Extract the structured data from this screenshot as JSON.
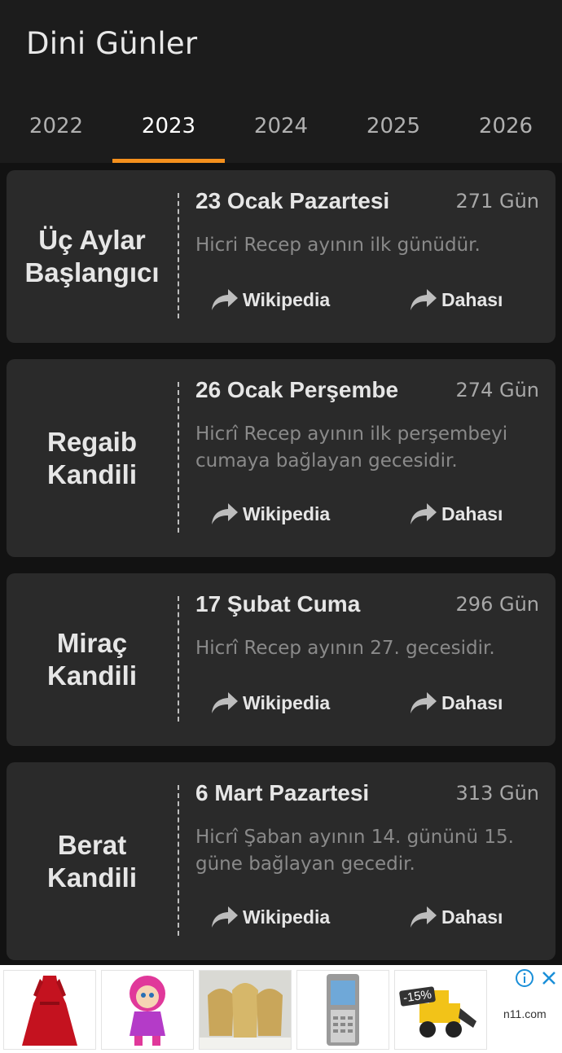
{
  "app": {
    "title": "Dini Günler"
  },
  "tabs": [
    {
      "label": "2022",
      "active": false
    },
    {
      "label": "2023",
      "active": true
    },
    {
      "label": "2024",
      "active": false
    },
    {
      "label": "2025",
      "active": false
    },
    {
      "label": "2026",
      "active": false
    }
  ],
  "accent_color": "#f5901d",
  "cards": [
    {
      "name": "Üç Aylar Başlangıcı",
      "date": "23 Ocak Pazartesi",
      "days": "271 Gün",
      "description": "Hicri Recep ayının ilk günüdür.",
      "wiki_label": "Wikipedia",
      "more_label": "Dahası"
    },
    {
      "name": "Regaib Kandili",
      "date": "26 Ocak Perşembe",
      "days": "274 Gün",
      "description": "Hicrî Recep ayının ilk perşembeyi cumaya bağlayan gecesidir.",
      "wiki_label": "Wikipedia",
      "more_label": "Dahası"
    },
    {
      "name": "Miraç Kandili",
      "date": "17 Şubat Cuma",
      "days": "296 Gün",
      "description": "Hicrî Recep ayının 27. gecesidir.",
      "wiki_label": "Wikipedia",
      "more_label": "Dahası"
    },
    {
      "name": "Berat Kandili",
      "date": "6 Mart Pazartesi",
      "days": "313 Gün",
      "description": "Hicrî Şaban ayının 14. gününü 15. güne bağlayan gecedir.",
      "wiki_label": "Wikipedia",
      "more_label": "Dahası"
    }
  ],
  "ad": {
    "discount_badge": "-15%",
    "brand": "n11.com",
    "products": [
      "red-dress",
      "masha-doll",
      "gold-jars",
      "nokia-phone",
      "toy-excavator"
    ]
  }
}
